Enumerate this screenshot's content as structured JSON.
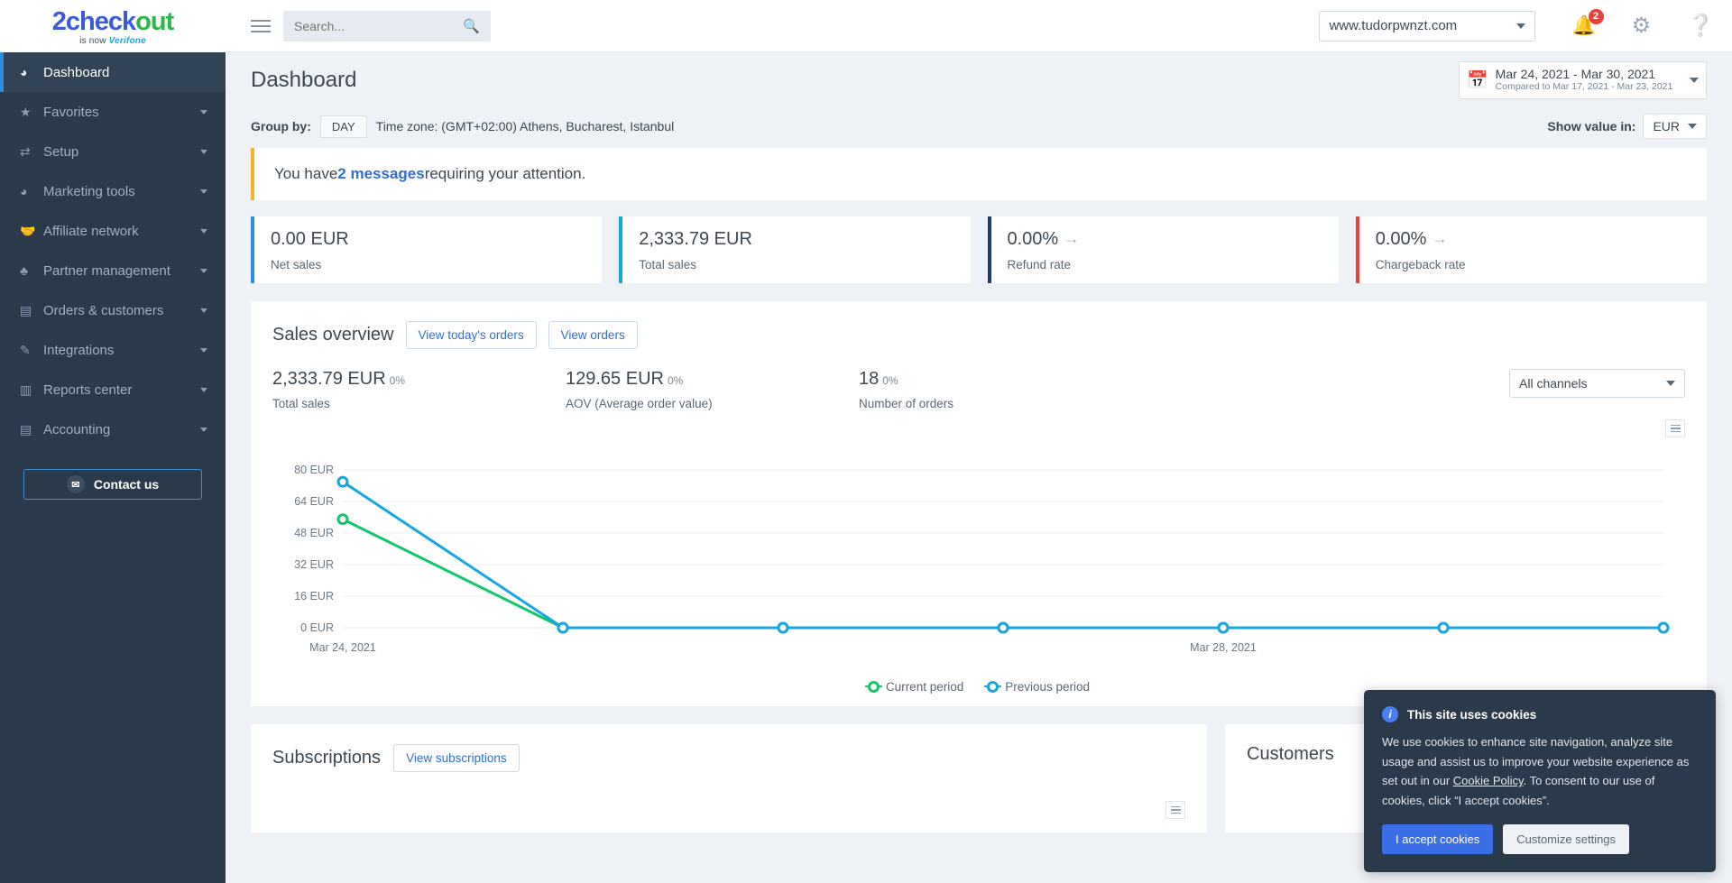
{
  "brand": {
    "logo_two": "2",
    "logo_check": "check",
    "logo_out": "out",
    "tagline_prefix": "is now ",
    "tagline_brand": "Verifone",
    "tagline_suffix": "®"
  },
  "sidebar": {
    "items": [
      {
        "label": "Dashboard",
        "icon": "dashboard-gauge-icon",
        "glyph": "◕",
        "active": true,
        "has_caret": false
      },
      {
        "label": "Favorites",
        "icon": "star-icon",
        "glyph": "★",
        "active": false,
        "has_caret": true
      },
      {
        "label": "Setup",
        "icon": "sliders-icon",
        "glyph": "⇄",
        "active": false,
        "has_caret": true
      },
      {
        "label": "Marketing tools",
        "icon": "pie-chart-icon",
        "glyph": "◕",
        "active": false,
        "has_caret": true
      },
      {
        "label": "Affiliate network",
        "icon": "handshake-icon",
        "glyph": "🤝",
        "active": false,
        "has_caret": true
      },
      {
        "label": "Partner management",
        "icon": "org-chart-icon",
        "glyph": "♣",
        "active": false,
        "has_caret": true
      },
      {
        "label": "Orders & customers",
        "icon": "clipboard-icon",
        "glyph": "▤",
        "active": false,
        "has_caret": true
      },
      {
        "label": "Integrations",
        "icon": "plug-icon",
        "glyph": "✎",
        "active": false,
        "has_caret": true
      },
      {
        "label": "Reports center",
        "icon": "bar-chart-icon",
        "glyph": "▥",
        "active": false,
        "has_caret": true
      },
      {
        "label": "Accounting",
        "icon": "coins-icon",
        "glyph": "▤",
        "active": false,
        "has_caret": true
      }
    ],
    "contact_button": "Contact us"
  },
  "topbar": {
    "search_placeholder": "Search...",
    "search_value": "",
    "account": "www.tudorpwnzt.com",
    "notifications_count": "2"
  },
  "page": {
    "title": "Dashboard",
    "date_range": "Mar 24, 2021 - Mar 30, 2021",
    "date_compare": "Compared to Mar 17, 2021 - Mar 23, 2021"
  },
  "controls": {
    "group_by_label": "Group by:",
    "group_by_value": "DAY",
    "timezone": "Time zone: (GMT+02:00) Athens, Bucharest, Istanbul",
    "show_value_label": "Show value in:",
    "currency": "EUR"
  },
  "message_bar": {
    "prefix": "You have ",
    "link": "2 messages",
    "suffix": " requiring your attention."
  },
  "kpis": [
    {
      "value": "0.00 EUR",
      "label": "Net sales",
      "arrow": "",
      "color": "#2b8fe3"
    },
    {
      "value": "2,333.79 EUR",
      "label": "Total sales",
      "arrow": "",
      "color": "#17a7e0"
    },
    {
      "value": "0.00%",
      "label": "Refund rate",
      "arrow": "→",
      "color": "#1f3d6e"
    },
    {
      "value": "0.00%",
      "label": "Chargeback rate",
      "arrow": "→",
      "color": "#e8413a"
    }
  ],
  "sales_overview": {
    "title": "Sales overview",
    "btn_today": "View today's orders",
    "btn_orders": "View orders",
    "metrics": [
      {
        "value": "2,333.79 EUR",
        "pct": "0%",
        "label": "Total sales"
      },
      {
        "value": "129.65 EUR",
        "pct": "0%",
        "label": "AOV (Average order value)"
      },
      {
        "value": "18",
        "pct": "0%",
        "label": "Number of orders"
      }
    ],
    "channel_filter": "All channels"
  },
  "chart_data": {
    "type": "line",
    "title": "",
    "xlabel": "",
    "ylabel": "",
    "ylim": [
      0,
      80
    ],
    "yticks": [
      0,
      16,
      32,
      48,
      64,
      80
    ],
    "ytick_labels": [
      "0 EUR",
      "16 EUR",
      "32 EUR",
      "48 EUR",
      "64 EUR",
      "80 EUR"
    ],
    "x": [
      "Mar 24, 2021",
      "Mar 25, 2021",
      "Mar 26, 2021",
      "Mar 27, 2021",
      "Mar 28, 2021",
      "Mar 29, 2021",
      "Mar 30, 2021"
    ],
    "xtick_labels_shown": [
      "Mar 24, 2021",
      "Mar 28, 2021"
    ],
    "xtick_shown_indices": [
      0,
      4
    ],
    "grid": true,
    "legend_position": "bottom",
    "series": [
      {
        "name": "Current period",
        "color": "#13c56b",
        "values": [
          55,
          0,
          0,
          0,
          0,
          0,
          0
        ]
      },
      {
        "name": "Previous period",
        "color": "#17a7e0",
        "values": [
          74,
          0,
          0,
          0,
          0,
          0,
          0
        ]
      }
    ],
    "legend": [
      "Current period",
      "Previous period"
    ]
  },
  "subscriptions": {
    "title": "Subscriptions",
    "button": "View subscriptions"
  },
  "customers": {
    "title": "Customers"
  },
  "cookie_banner": {
    "title": "This site uses cookies",
    "body_part1": "We use cookies to enhance site navigation, analyze site usage and assist us to improve your website experience as set out in our ",
    "policy_link": "Cookie Policy",
    "body_part2": ". To consent to our use of cookies, click “I accept cookies”.",
    "accept_label": "I accept cookies",
    "customize_label": "Customize settings"
  }
}
